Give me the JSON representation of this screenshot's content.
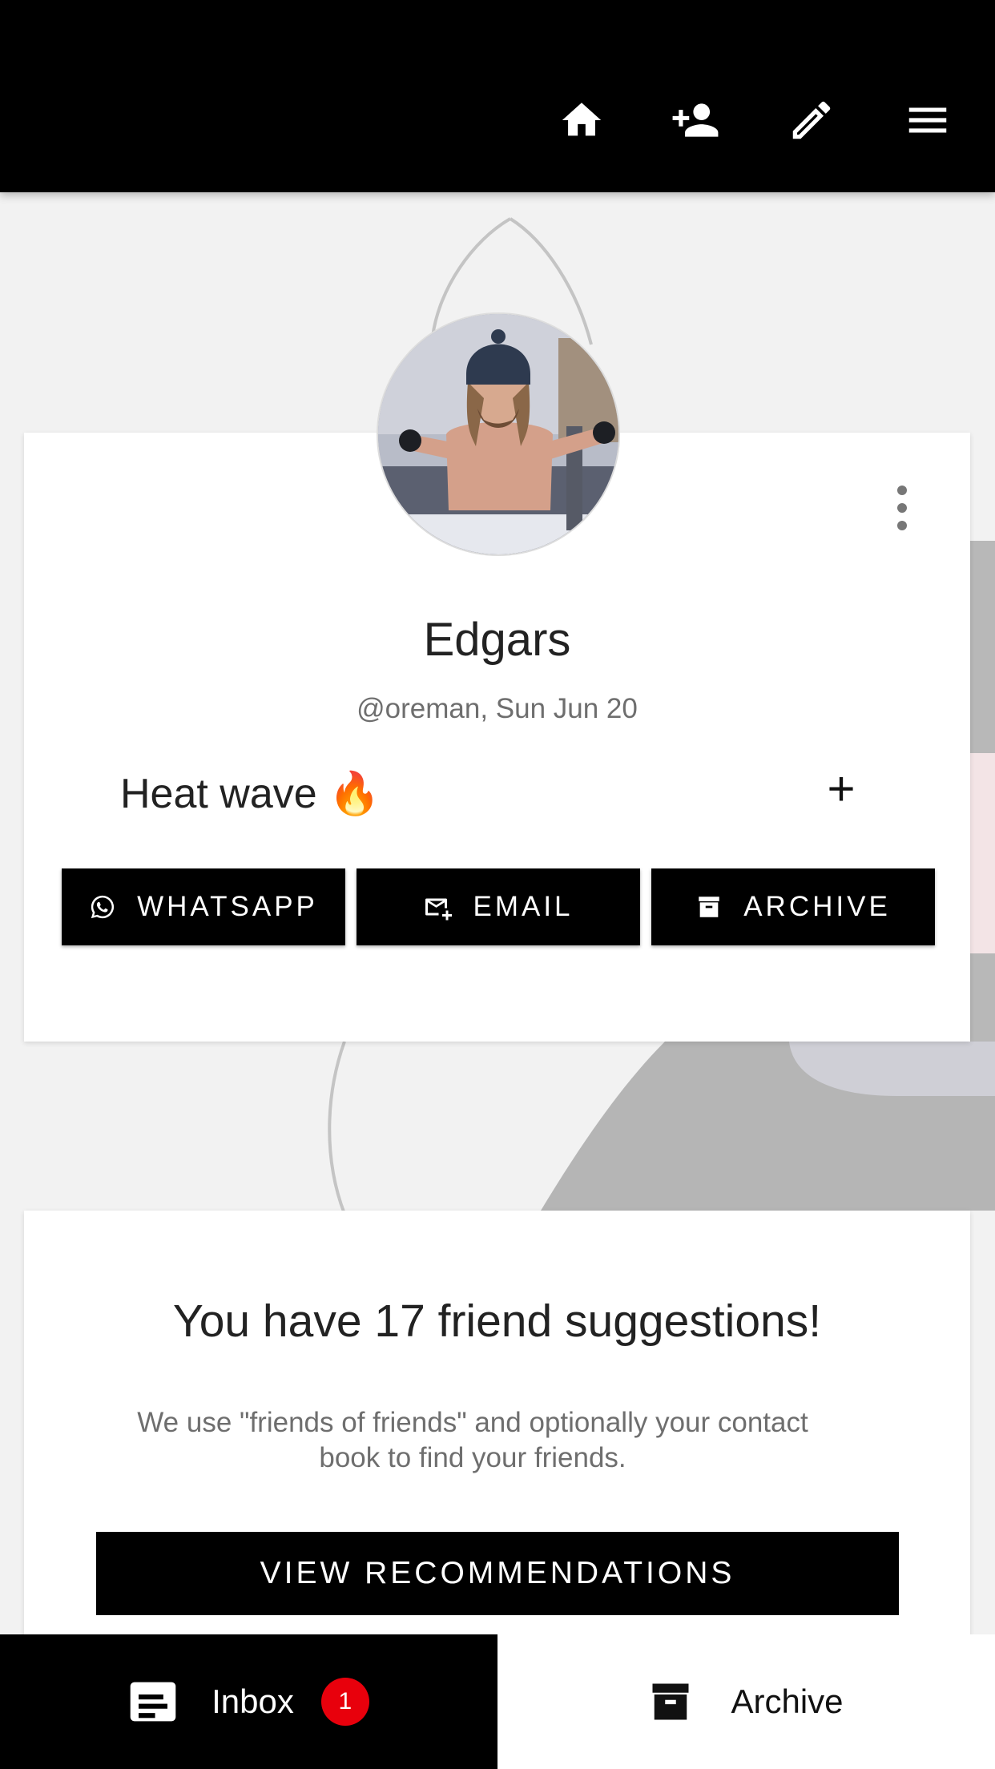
{
  "colors": {
    "bar": "#000000",
    "background": "#f2f2f2",
    "card": "#ffffff",
    "badge": "#e8000c"
  },
  "header": {
    "icons": [
      "home-icon",
      "add-person-icon",
      "edit-pencil-icon",
      "menu-icon"
    ]
  },
  "profile": {
    "name": "Edgars",
    "meta": "@oreman, Sun Jun 20",
    "status": "Heat wave 🔥",
    "add_label": "+",
    "actions": [
      {
        "label": "WHATSAPP",
        "icon": "whatsapp-icon"
      },
      {
        "label": "EMAIL",
        "icon": "email-icon"
      },
      {
        "label": "ARCHIVE",
        "icon": "archive-icon"
      }
    ]
  },
  "suggestions": {
    "title": "You have 17 friend suggestions!",
    "description": "We use \"friends of friends\" and optionally your contact book to find your friends.",
    "button": "VIEW RECOMMENDATIONS"
  },
  "bottom_nav": {
    "inbox_label": "Inbox",
    "inbox_count": "1",
    "archive_label": "Archive"
  }
}
